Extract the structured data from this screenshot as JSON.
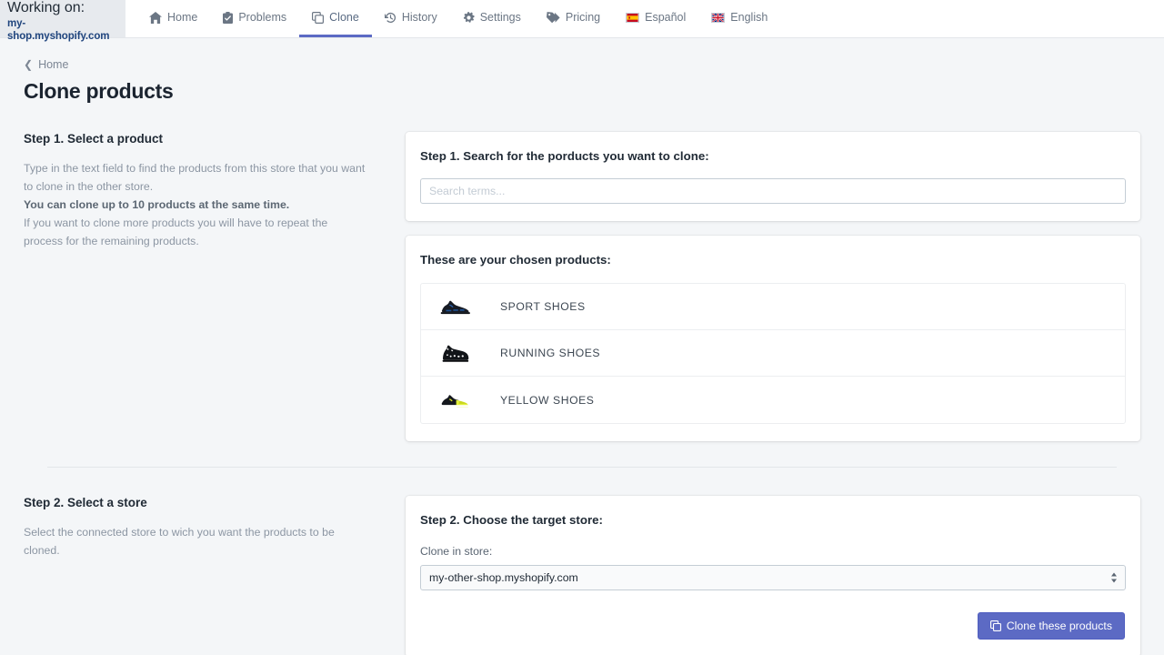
{
  "topbar": {
    "working_label": "Working on:",
    "working_shop": "my-shop.myshopify.com",
    "nav": [
      {
        "label": "Home",
        "icon": "home-icon",
        "active": false
      },
      {
        "label": "Problems",
        "icon": "clipboard-check-icon",
        "active": false
      },
      {
        "label": "Clone",
        "icon": "copy-icon",
        "active": true
      },
      {
        "label": "History",
        "icon": "history-icon",
        "active": false
      },
      {
        "label": "Settings",
        "icon": "gear-icon",
        "active": false
      },
      {
        "label": "Pricing",
        "icon": "tag-icon",
        "active": false
      },
      {
        "label": "Español",
        "icon": "flag-spain-icon",
        "active": false
      },
      {
        "label": "English",
        "icon": "flag-uk-icon",
        "active": false
      }
    ]
  },
  "breadcrumb": {
    "label": "Home"
  },
  "page_title": "Clone products",
  "step1": {
    "aside_title": "Step 1. Select a product",
    "aside_text_1": "Type in the text field to find the products from this store that you want to clone in the other store.",
    "aside_text_bold": "You can clone up to 10 products at the same time.",
    "aside_text_2": "If you want to clone more products you will have to repeat the process for the remaining products.",
    "card_title": "Step 1. Search for the porducts you want to clone:",
    "search_value": "",
    "search_placeholder": "Search terms...",
    "chosen_title": "These are your chosen products:",
    "products": [
      {
        "name": "SPORT SHOES",
        "thumb": "sneaker-navy-icon"
      },
      {
        "name": "RUNNING SHOES",
        "thumb": "sneaker-black-white-icon"
      },
      {
        "name": "YELLOW SHOES",
        "thumb": "sneaker-yellow-icon"
      }
    ]
  },
  "step2": {
    "aside_title": "Step 2. Select a store",
    "aside_text": "Select the connected store to wich you want the products to be cloned.",
    "card_title": "Step 2. Choose the target store:",
    "field_label": "Clone in store:",
    "store_selected": "my-other-shop.myshopify.com",
    "store_options": [
      "my-other-shop.myshopify.com"
    ],
    "submit_label": "Clone these products",
    "submit_icon": "copy-icon"
  },
  "colors": {
    "accent": "#5c6ac4",
    "page_bg": "#f4f6f8",
    "text": "#212b36",
    "muted": "#8c96a3",
    "shop_blue": "#20457e"
  }
}
